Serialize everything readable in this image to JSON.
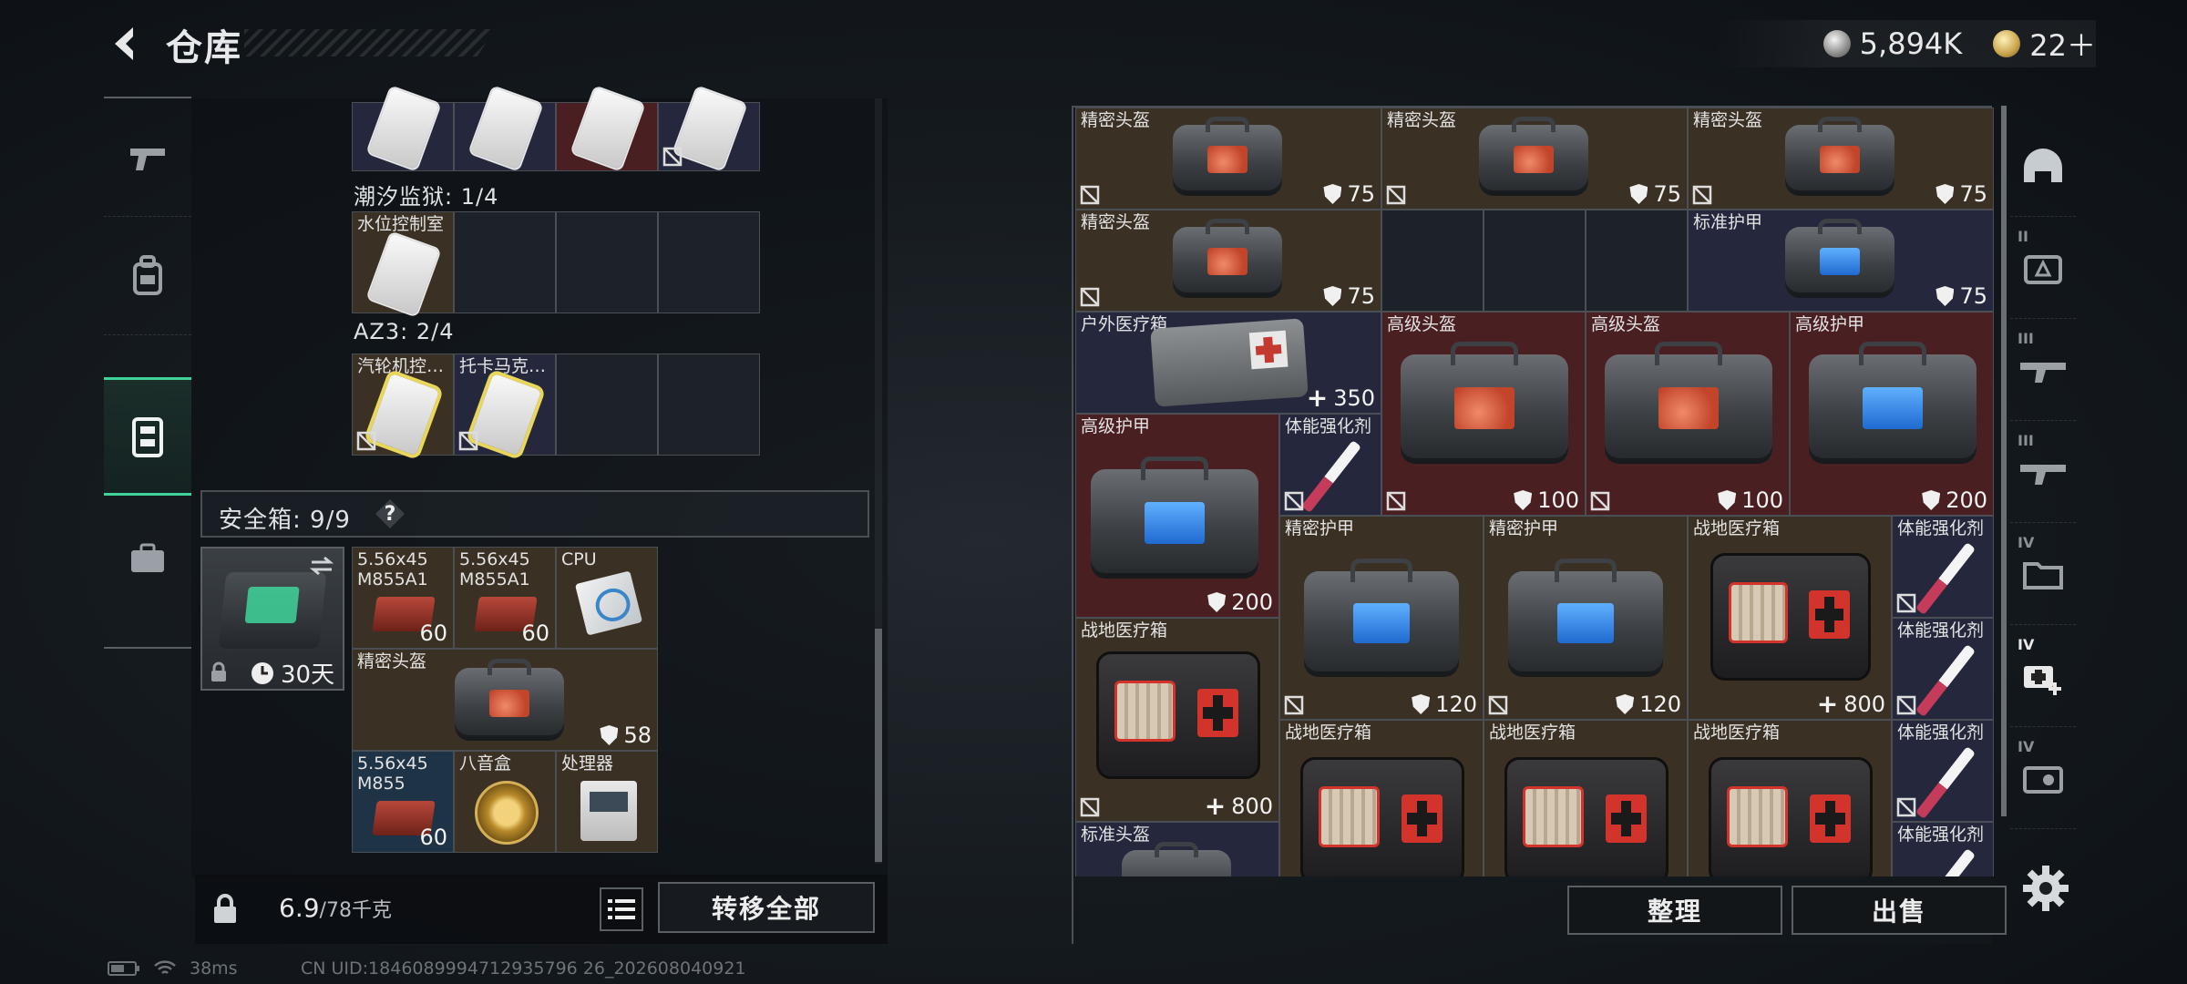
{
  "header": {
    "title": "仓库",
    "currency_silver": "5,894K",
    "currency_gold": "22＋"
  },
  "left": {
    "groups": [
      {
        "label": "潮汐监狱: 1/4",
        "items": [
          "水位控制室"
        ]
      },
      {
        "label": "AZ3: 2/4",
        "items": [
          "汽轮机控…",
          "托卡马克…"
        ]
      }
    ],
    "safebox": {
      "label": "安全箱: 9/9",
      "help": "?",
      "days": "30天",
      "items": [
        {
          "name": "5.56x45\nM855A1",
          "qty": "60"
        },
        {
          "name": "5.56x45\nM855A1",
          "qty": "60"
        },
        {
          "name": "CPU",
          "qty": ""
        },
        {
          "name": "精密头盔",
          "stat": "58"
        },
        {
          "name": "5.56x45\nM855",
          "qty": "60"
        },
        {
          "name": "八音盒",
          "qty": ""
        },
        {
          "name": "处理器",
          "qty": ""
        }
      ]
    },
    "weight": {
      "value": "6.9",
      "max": "/78千克"
    },
    "transfer_all": "转移全部"
  },
  "right": {
    "items": [
      {
        "name": "精密头盔",
        "stat": "75"
      },
      {
        "name": "精密头盔",
        "stat": "75"
      },
      {
        "name": "精密头盔",
        "stat": "75"
      },
      {
        "name": "精密头盔",
        "stat": "75"
      },
      {
        "name": "标准护甲",
        "stat": "75"
      },
      {
        "name": "户外医疗箱",
        "heal": "350"
      },
      {
        "name": "高级头盔",
        "stat": "100"
      },
      {
        "name": "高级头盔",
        "stat": "100"
      },
      {
        "name": "高级护甲",
        "stat": "200"
      },
      {
        "name": "高级护甲",
        "stat": "200"
      },
      {
        "name": "体能强化剂"
      },
      {
        "name": "精密护甲",
        "stat": "120"
      },
      {
        "name": "精密护甲",
        "stat": "120"
      },
      {
        "name": "战地医疗箱",
        "heal": "800"
      },
      {
        "name": "体能强化剂"
      },
      {
        "name": "战地医疗箱",
        "heal": "800"
      },
      {
        "name": "体能强化剂"
      },
      {
        "name": "战地医疗箱"
      },
      {
        "name": "战地医疗箱"
      },
      {
        "name": "战地医疗箱"
      },
      {
        "name": "体能强化剂"
      },
      {
        "name": "体能强化剂"
      },
      {
        "name": "标准头盔"
      }
    ],
    "sort_label": "整理",
    "sell_label": "出售",
    "tiers": [
      "II",
      "III",
      "III",
      "IV",
      "IV",
      "IV"
    ]
  },
  "status": {
    "ping": "38ms",
    "uid": "CN UID:1846089994712935796 26_202608040921"
  },
  "icons": [
    "back-arrow-icon",
    "weapon-icon",
    "backpack-icon",
    "safebox-icon",
    "briefcase-icon",
    "lock-icon",
    "clock-icon",
    "swap-icon",
    "list-icon",
    "shield-icon",
    "no-trade-icon",
    "settings-gear-icon"
  ]
}
